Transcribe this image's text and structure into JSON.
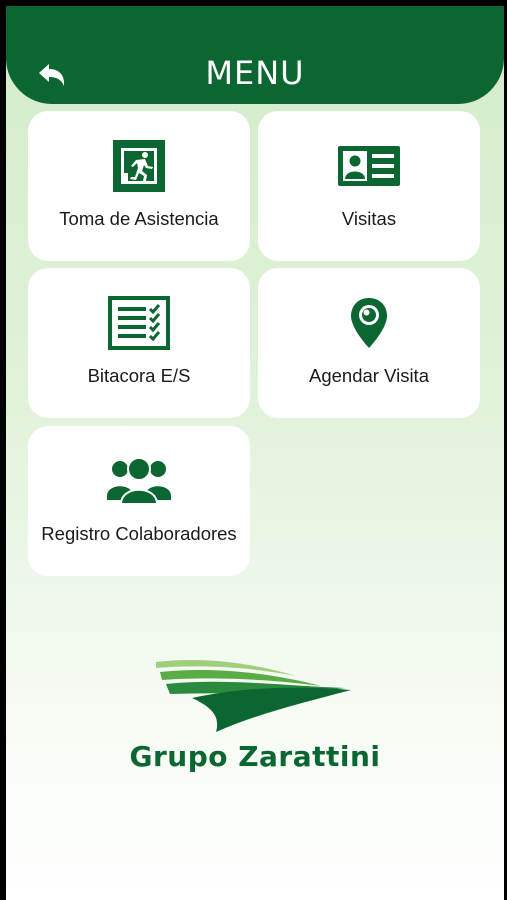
{
  "header": {
    "title": "MENU",
    "back_icon": "back-arrow-icon",
    "color": "#0b6632"
  },
  "menu": {
    "items": [
      {
        "label": "Toma de Asistencia",
        "icon": "emergency-exit-icon"
      },
      {
        "label": "Visitas",
        "icon": "id-card-icon"
      },
      {
        "label": "Bitacora E/S",
        "icon": "checklist-icon"
      },
      {
        "label": "Agendar Visita",
        "icon": "location-pin-icon"
      },
      {
        "label": "Registro Colaboradores",
        "icon": "group-users-icon"
      }
    ]
  },
  "brand": {
    "name": "Grupo Zarattini",
    "color": "#0b6632"
  }
}
